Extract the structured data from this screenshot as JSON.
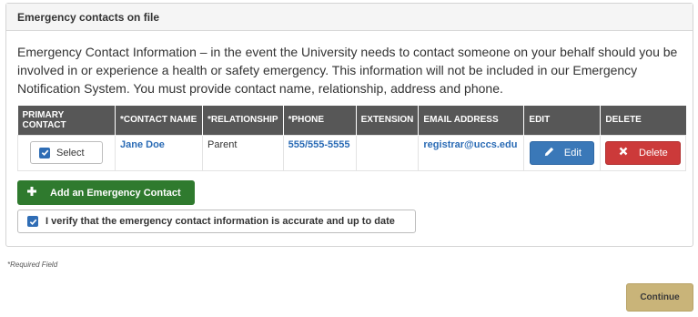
{
  "panel": {
    "title": "Emergency contacts on file",
    "description": "Emergency Contact Information – in the event the University needs to contact someone on your behalf should you be involved in or experience a health or safety emergency. This information will not be included in our Emergency Notification System. You must provide contact name, relationship, address and phone."
  },
  "table": {
    "headers": {
      "primary_line1": "PRIMARY",
      "primary_line2": "CONTACT",
      "name": "*CONTACT NAME",
      "relationship": "*RELATIONSHIP",
      "phone": "*PHONE",
      "extension": "EXTENSION",
      "email": "EMAIL ADDRESS",
      "edit": "EDIT",
      "delete": "DELETE"
    },
    "rows": [
      {
        "select_label": "Select",
        "name": "Jane Doe",
        "relationship": "Parent",
        "phone": "555/555-5555",
        "extension": "",
        "email": "registrar@uccs.edu",
        "edit_label": "Edit",
        "delete_label": "Delete"
      }
    ]
  },
  "add_button_label": "Add an Emergency Contact",
  "verify_label": "I verify that the emergency contact information is accurate and up to date",
  "required_note": "*Required Field",
  "continue_label": "Continue",
  "colors": {
    "header_bg": "#575757",
    "link": "#2a6bb5",
    "edit_button": "#3a78b8",
    "delete_button": "#cc3a3a",
    "add_button": "#2f7a2e",
    "continue_button": "#c9b479"
  }
}
